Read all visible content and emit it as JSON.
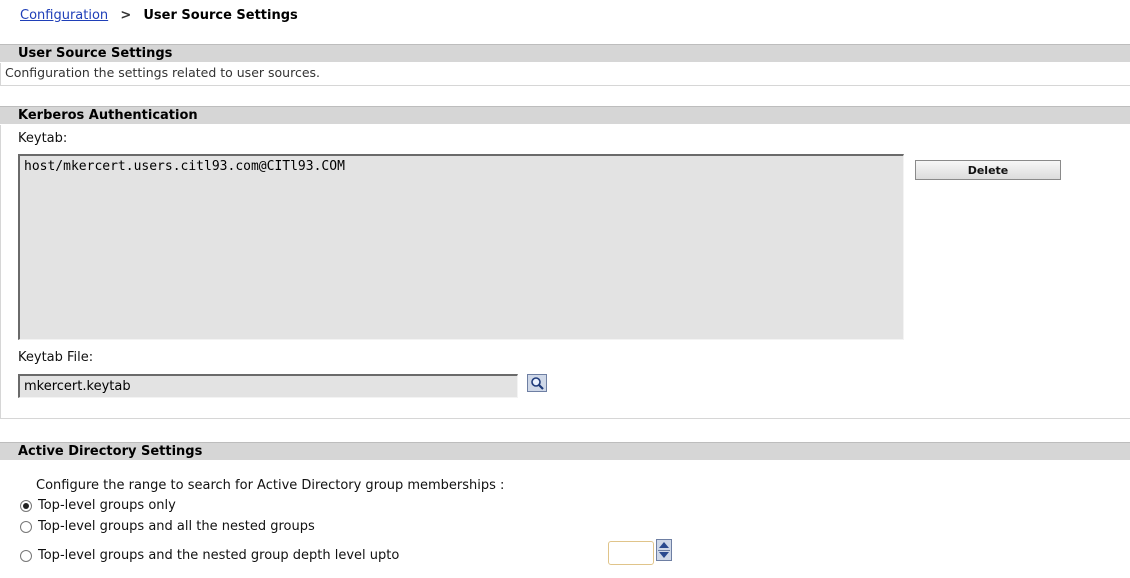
{
  "breadcrumb": {
    "parent": "Configuration",
    "separator": ">",
    "current": "User Source Settings"
  },
  "user_source": {
    "title": "User Source Settings",
    "description": "Configuration the settings related to user sources."
  },
  "kerberos": {
    "title": "Kerberos Authentication",
    "keytab_label": "Keytab:",
    "keytab_entries": [
      "host/mkercert.users.citl93.com@CITl93.COM"
    ],
    "delete_label": "Delete",
    "keytab_file_label": "Keytab File:",
    "keytab_file_value": "mkercert.keytab",
    "browse_icon": "magnifier-icon"
  },
  "active_directory": {
    "title": "Active Directory Settings",
    "prompt": "Configure the range to search for Active Directory group memberships :",
    "options": [
      {
        "label": "Top-level groups only",
        "selected": true
      },
      {
        "label": "Top-level groups and all the nested groups",
        "selected": false
      },
      {
        "label": "Top-level groups and the nested group depth level upto",
        "selected": false
      }
    ],
    "depth_value": ""
  },
  "colors": {
    "header_bg": "#d6d6d6",
    "link": "#1f3fb8",
    "field_bg": "#e3e3e3"
  }
}
